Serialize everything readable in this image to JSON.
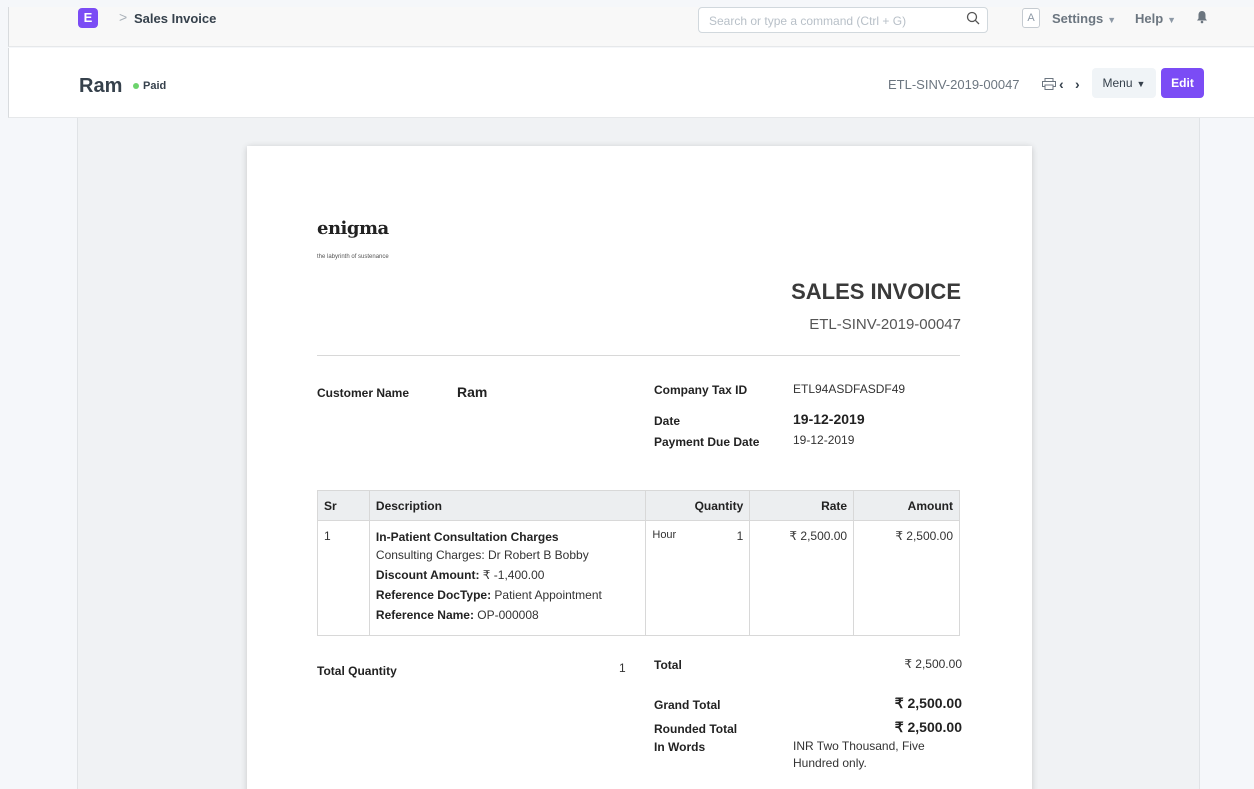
{
  "navbar": {
    "logo_letter": "E",
    "breadcrumb_sep": ">",
    "breadcrumb": "Sales Invoice",
    "search_placeholder": "Search or type a command (Ctrl + G)",
    "avatar_letter": "A",
    "settings_label": "Settings",
    "help_label": "Help"
  },
  "page": {
    "title": "Ram",
    "status": "Paid",
    "status_color": "#6cd36c",
    "doc_name": "ETL-SINV-2019-00047",
    "menu_label": "Menu",
    "edit_label": "Edit"
  },
  "invoice": {
    "brand": "enigma",
    "tagline": "the labyrinth of sustenance",
    "title": "SALES INVOICE",
    "number": "ETL-SINV-2019-00047",
    "customer_label": "Customer Name",
    "customer_value": "Ram",
    "tax_id_label": "Company Tax ID",
    "tax_id_value": "ETL94ASDFASDF49",
    "date_label": "Date",
    "date_value": "19-12-2019",
    "due_label": "Payment Due Date",
    "due_value": "19-12-2019",
    "columns": [
      "Sr",
      "Description",
      "Quantity",
      "Rate",
      "Amount"
    ],
    "items": [
      {
        "sr": "1",
        "name": "In-Patient Consultation Charges",
        "description": "Consulting Charges: Dr Robert B Bobby",
        "discount_label": "Discount Amount:",
        "discount_value": " ₹ -1,400.00",
        "ref_doctype_label": "Reference DocType:",
        "ref_doctype_value": " Patient Appointment",
        "ref_name_label": "Reference Name:",
        "ref_name_value": " OP-000008",
        "uom": "Hour",
        "qty": "1",
        "rate": "₹ 2,500.00",
        "amount": "₹ 2,500.00"
      }
    ],
    "total_qty_label": "Total Quantity",
    "total_qty_value": "1",
    "total_label": "Total",
    "total_value": "₹ 2,500.00",
    "grand_total_label": "Grand Total",
    "grand_total_value": "₹ 2,500.00",
    "rounded_total_label": "Rounded Total",
    "rounded_total_value": "₹ 2,500.00",
    "in_words_label": "In Words",
    "in_words_line1": "INR Two Thousand, Five",
    "in_words_line2": "Hundred only."
  },
  "colors": {
    "accent": "#7b4cf5",
    "paid": "#6cd36c"
  }
}
